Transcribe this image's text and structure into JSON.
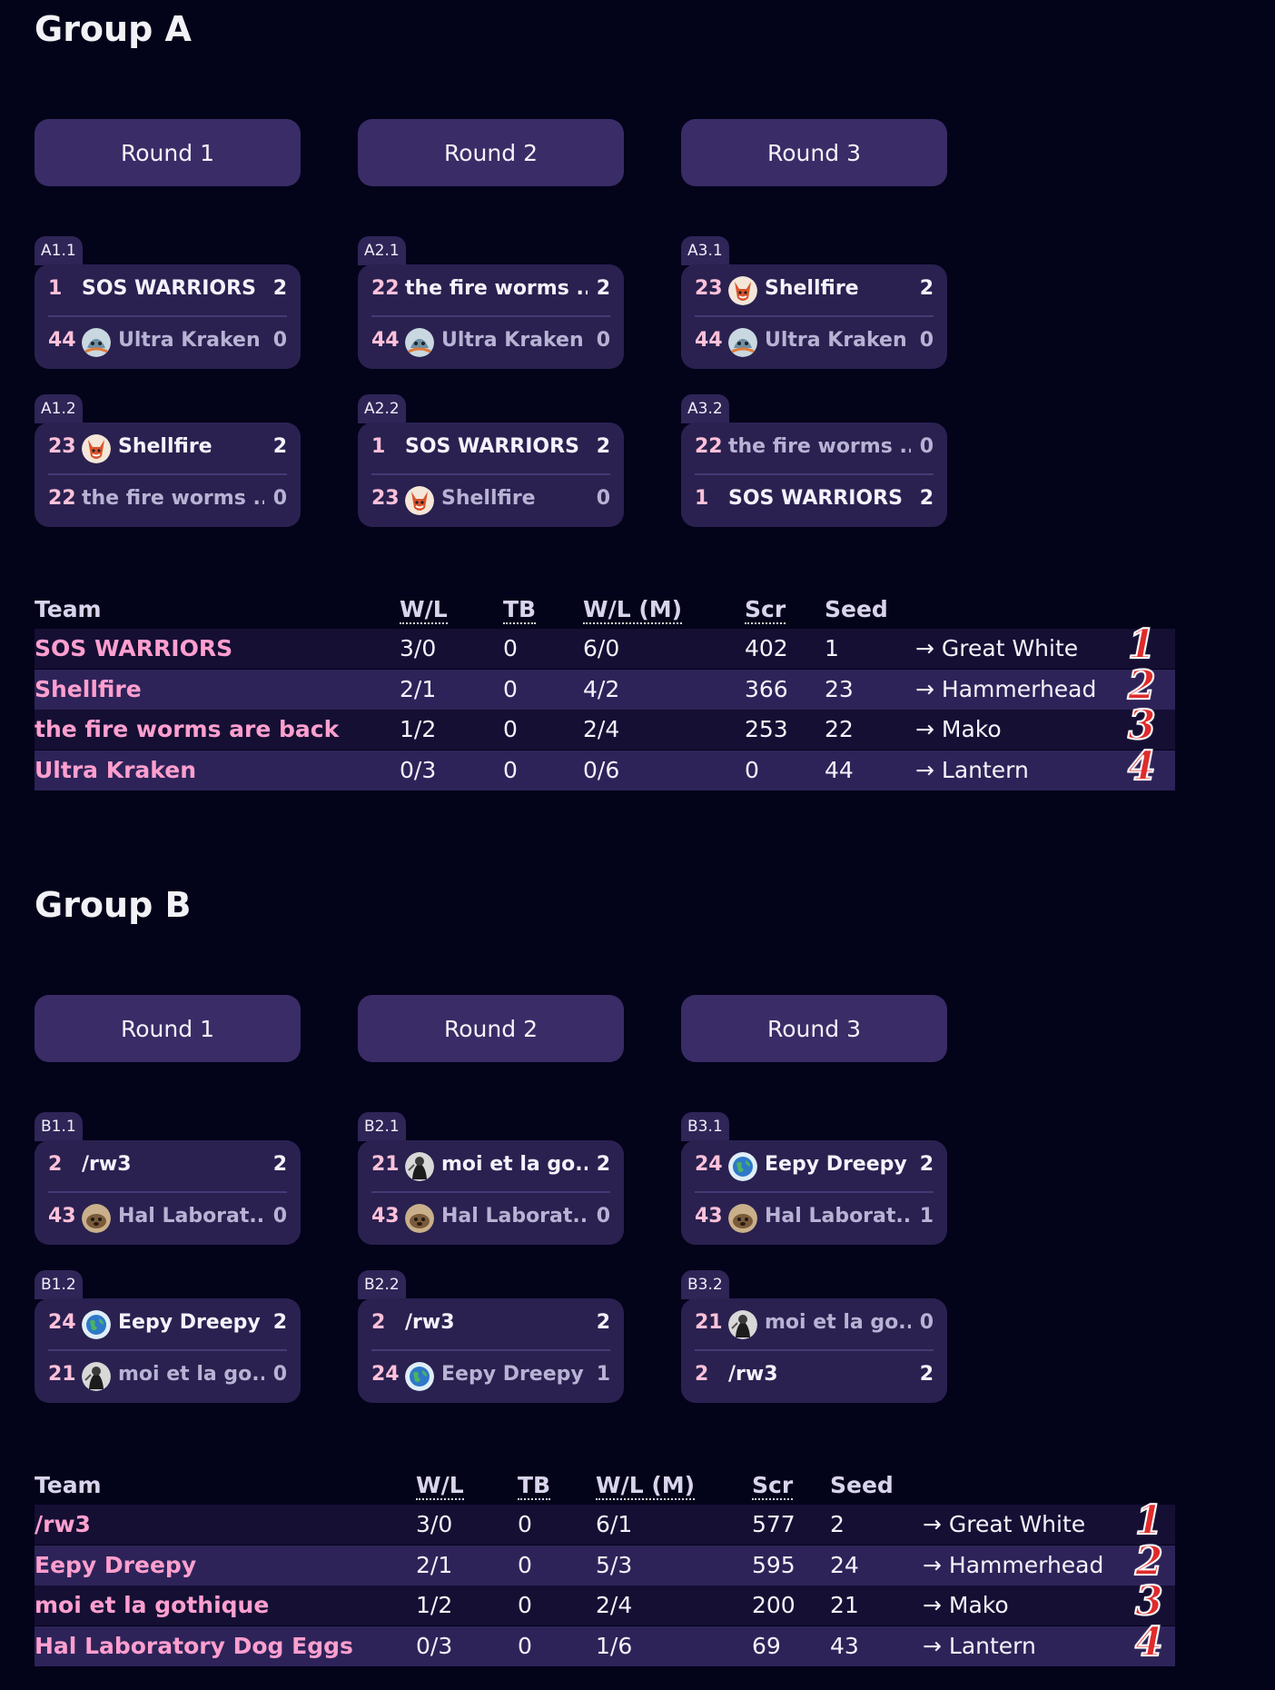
{
  "groups": [
    {
      "title": "Group A",
      "rounds": [
        "Round 1",
        "Round 2",
        "Round 3"
      ],
      "matches": [
        {
          "label": "A1.1",
          "teams": [
            {
              "seed": "1",
              "name": "SOS WARRIORS",
              "score": "2",
              "avatar": "",
              "win": true
            },
            {
              "seed": "44",
              "name": "Ultra Kraken",
              "score": "0",
              "avatar": "kraken",
              "win": false
            }
          ]
        },
        {
          "label": "A1.2",
          "teams": [
            {
              "seed": "23",
              "name": "Shellfire",
              "score": "2",
              "avatar": "fox",
              "win": true
            },
            {
              "seed": "22",
              "name": "the fire worms ...",
              "score": "0",
              "avatar": "",
              "win": false
            }
          ]
        },
        {
          "label": "A2.1",
          "teams": [
            {
              "seed": "22",
              "name": "the fire worms ...",
              "score": "2",
              "avatar": "",
              "win": true
            },
            {
              "seed": "44",
              "name": "Ultra Kraken",
              "score": "0",
              "avatar": "kraken",
              "win": false
            }
          ]
        },
        {
          "label": "A2.2",
          "teams": [
            {
              "seed": "1",
              "name": "SOS WARRIORS",
              "score": "2",
              "avatar": "",
              "win": true
            },
            {
              "seed": "23",
              "name": "Shellfire",
              "score": "0",
              "avatar": "fox",
              "win": false
            }
          ]
        },
        {
          "label": "A3.1",
          "teams": [
            {
              "seed": "23",
              "name": "Shellfire",
              "score": "2",
              "avatar": "fox",
              "win": true
            },
            {
              "seed": "44",
              "name": "Ultra Kraken",
              "score": "0",
              "avatar": "kraken",
              "win": false
            }
          ]
        },
        {
          "label": "A3.2",
          "teams": [
            {
              "seed": "22",
              "name": "the fire worms ...",
              "score": "0",
              "avatar": "",
              "win": false
            },
            {
              "seed": "1",
              "name": "SOS WARRIORS",
              "score": "2",
              "avatar": "",
              "win": true
            }
          ]
        }
      ],
      "standings": {
        "headers": [
          "Team",
          "W/L",
          "TB",
          "W/L (M)",
          "Scr",
          "Seed"
        ],
        "rows": [
          {
            "team": "SOS WARRIORS",
            "wl": "3/0",
            "tb": "0",
            "wlm": "6/0",
            "scr": "402",
            "seed": "1",
            "dest": "→ Great White",
            "place": "1"
          },
          {
            "team": "Shellfire",
            "wl": "2/1",
            "tb": "0",
            "wlm": "4/2",
            "scr": "366",
            "seed": "23",
            "dest": "→ Hammerhead",
            "place": "2"
          },
          {
            "team": "the fire worms are back",
            "wl": "1/2",
            "tb": "0",
            "wlm": "2/4",
            "scr": "253",
            "seed": "22",
            "dest": "→ Mako",
            "place": "3"
          },
          {
            "team": "Ultra Kraken",
            "wl": "0/3",
            "tb": "0",
            "wlm": "0/6",
            "scr": "0",
            "seed": "44",
            "dest": "→ Lantern",
            "place": "4"
          }
        ]
      }
    },
    {
      "title": "Group B",
      "rounds": [
        "Round 1",
        "Round 2",
        "Round 3"
      ],
      "matches": [
        {
          "label": "B1.1",
          "teams": [
            {
              "seed": "2",
              "name": "/rw3",
              "score": "2",
              "avatar": "",
              "win": true
            },
            {
              "seed": "43",
              "name": "Hal Laborat...",
              "score": "0",
              "avatar": "dog",
              "win": false
            }
          ]
        },
        {
          "label": "B1.2",
          "teams": [
            {
              "seed": "24",
              "name": "Eepy Dreepy",
              "score": "2",
              "avatar": "globe",
              "win": true
            },
            {
              "seed": "21",
              "name": "moi et la go...",
              "score": "0",
              "avatar": "goth",
              "win": false
            }
          ]
        },
        {
          "label": "B2.1",
          "teams": [
            {
              "seed": "21",
              "name": "moi et la go...",
              "score": "2",
              "avatar": "goth",
              "win": true
            },
            {
              "seed": "43",
              "name": "Hal Laborat...",
              "score": "0",
              "avatar": "dog",
              "win": false
            }
          ]
        },
        {
          "label": "B2.2",
          "teams": [
            {
              "seed": "2",
              "name": "/rw3",
              "score": "2",
              "avatar": "",
              "win": true
            },
            {
              "seed": "24",
              "name": "Eepy Dreepy",
              "score": "1",
              "avatar": "globe",
              "win": false
            }
          ]
        },
        {
          "label": "B3.1",
          "teams": [
            {
              "seed": "24",
              "name": "Eepy Dreepy",
              "score": "2",
              "avatar": "globe",
              "win": true
            },
            {
              "seed": "43",
              "name": "Hal Laborat...",
              "score": "1",
              "avatar": "dog",
              "win": false
            }
          ]
        },
        {
          "label": "B3.2",
          "teams": [
            {
              "seed": "21",
              "name": "moi et la go...",
              "score": "0",
              "avatar": "goth",
              "win": false
            },
            {
              "seed": "2",
              "name": "/rw3",
              "score": "2",
              "avatar": "",
              "win": true
            }
          ]
        }
      ],
      "standings": {
        "headers": [
          "Team",
          "W/L",
          "TB",
          "W/L (M)",
          "Scr",
          "Seed"
        ],
        "rows": [
          {
            "team": "/rw3",
            "wl": "3/0",
            "tb": "0",
            "wlm": "6/1",
            "scr": "577",
            "seed": "2",
            "dest": "→ Great White",
            "place": "1"
          },
          {
            "team": "Eepy Dreepy",
            "wl": "2/1",
            "tb": "0",
            "wlm": "5/3",
            "scr": "595",
            "seed": "24",
            "dest": "→ Hammerhead",
            "place": "2"
          },
          {
            "team": "moi et la gothique",
            "wl": "1/2",
            "tb": "0",
            "wlm": "2/4",
            "scr": "200",
            "seed": "21",
            "dest": "→ Mako",
            "place": "3"
          },
          {
            "team": "Hal Laboratory Dog Eggs",
            "wl": "0/3",
            "tb": "0",
            "wlm": "1/6",
            "scr": "69",
            "seed": "43",
            "dest": "→ Lantern",
            "place": "4"
          }
        ]
      }
    }
  ],
  "colors": {
    "background": "#03031a",
    "card": "#2a2150",
    "round_button": "#3a2c66",
    "seed_text": "#ffc1d9",
    "team_link": "#ff9fcf",
    "place_marker": "#e02b2b"
  }
}
